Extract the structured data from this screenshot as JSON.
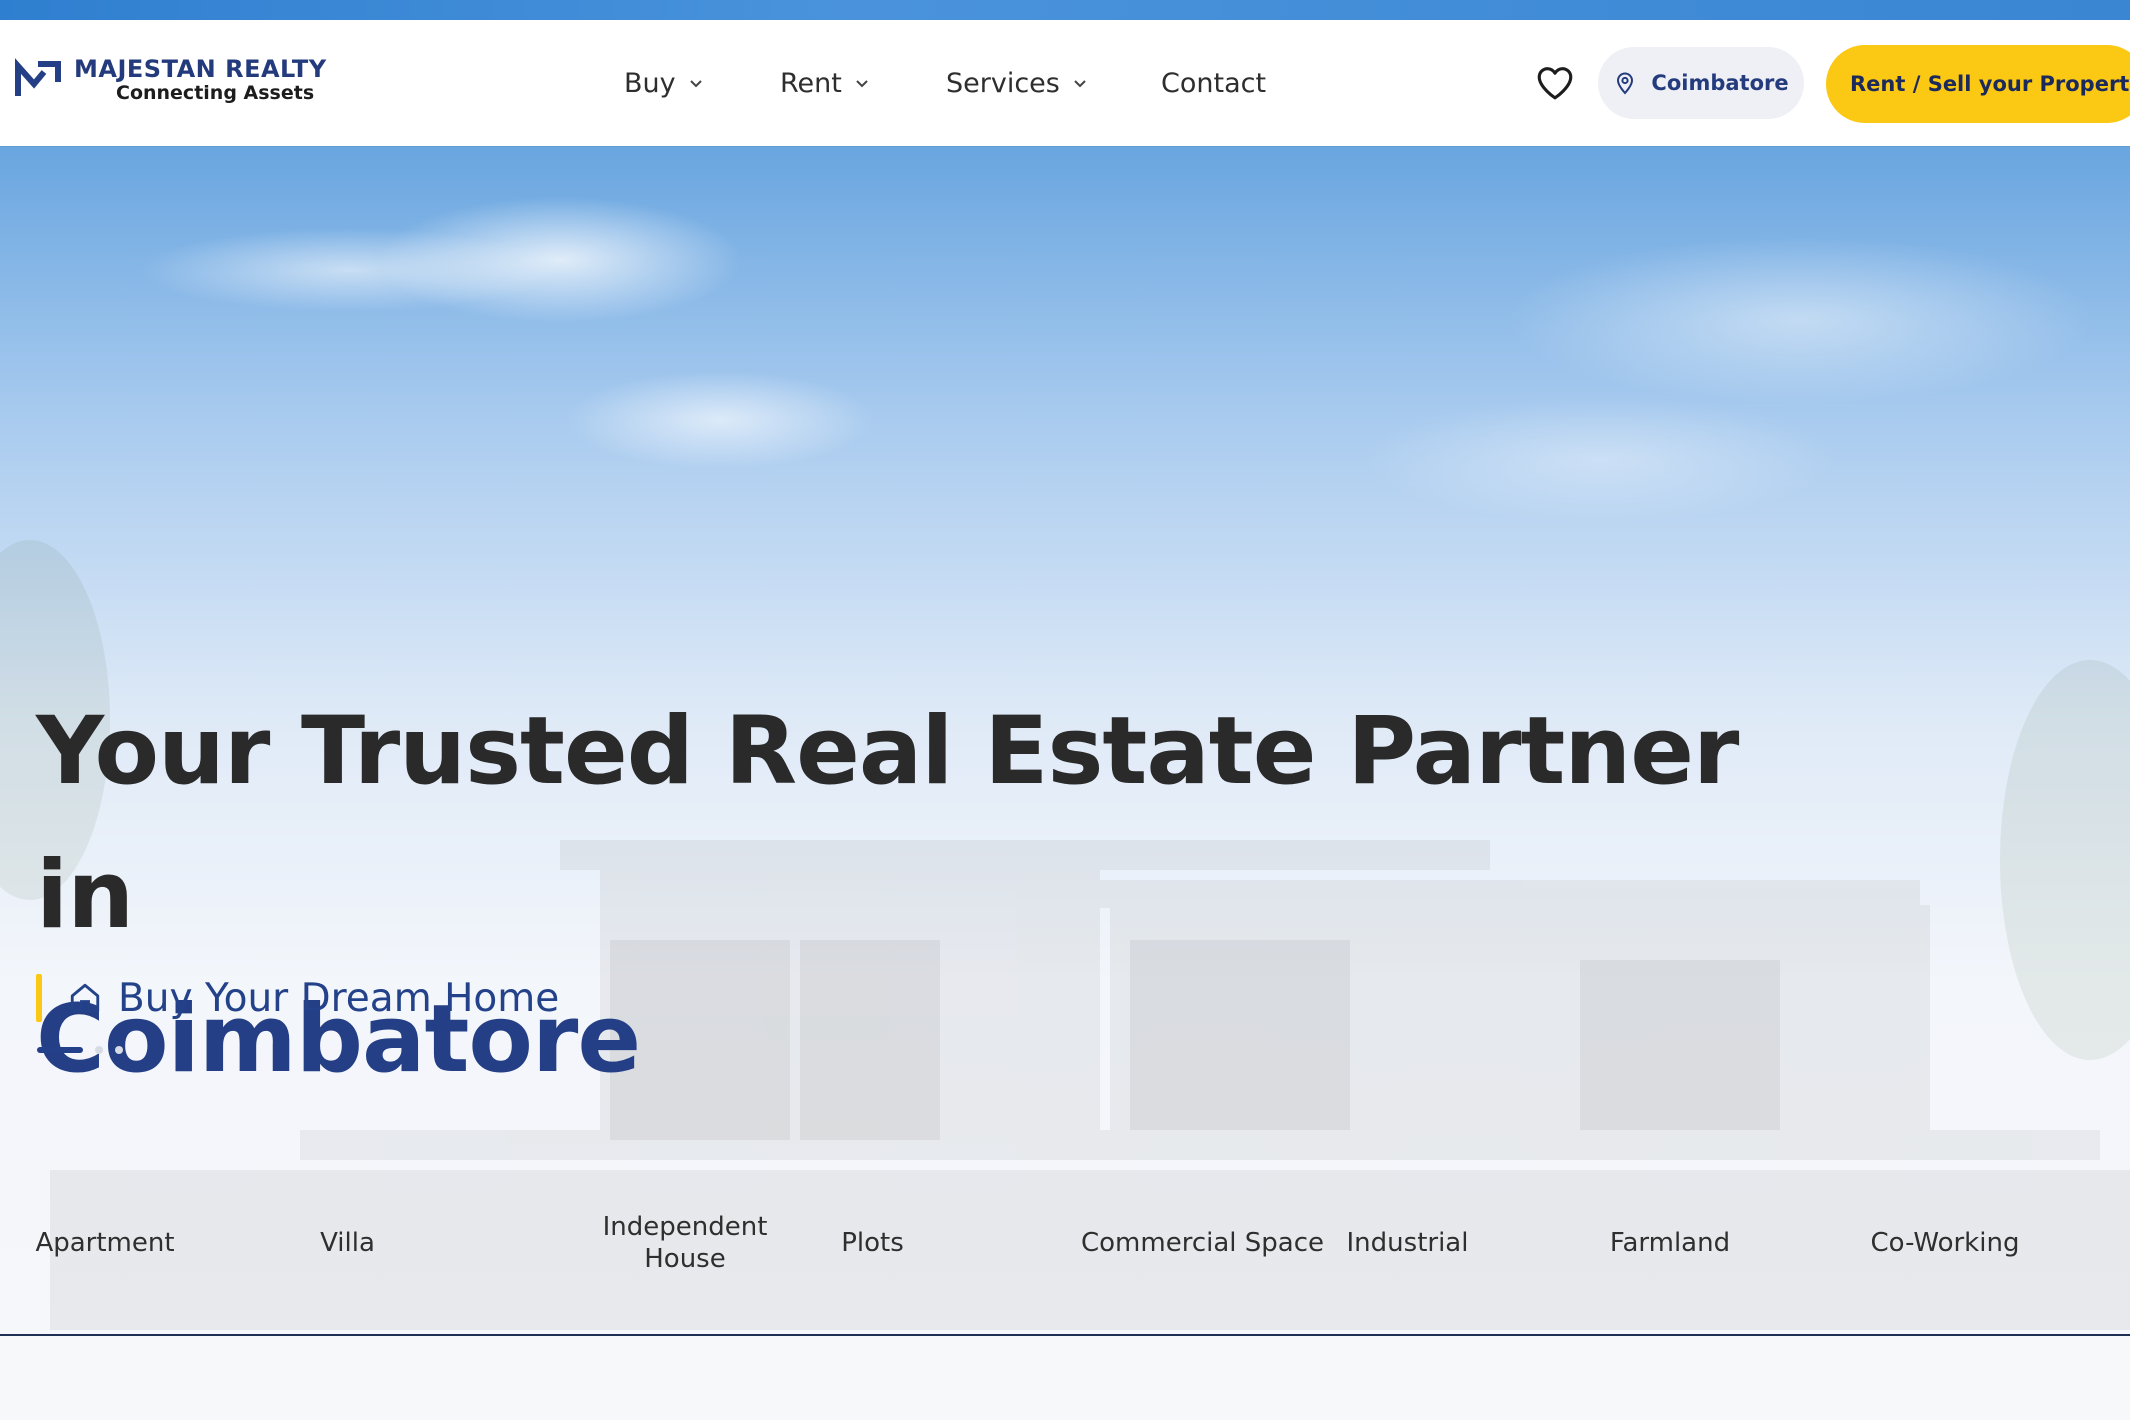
{
  "brand": {
    "name": "MAJESTAN REALTY",
    "tagline": "Connecting Assets",
    "primary_color": "#243f86",
    "accent_color": "#fbc813"
  },
  "nav": {
    "items": [
      {
        "label": "Buy",
        "has_dropdown": true
      },
      {
        "label": "Rent",
        "has_dropdown": true
      },
      {
        "label": "Services",
        "has_dropdown": true
      },
      {
        "label": "Contact",
        "has_dropdown": false
      }
    ]
  },
  "header": {
    "favorites_icon": "heart-icon",
    "location_label": "Coimbatore",
    "location_icon": "map-pin-icon",
    "cta_label": "Rent / Sell your Property"
  },
  "hero": {
    "title_line1": "Your Trusted Real Estate Partner in",
    "title_city": "Coimbatore",
    "tagline": "Buy Your Dream Home",
    "tagline_icon": "home-icon",
    "slides_total": 3,
    "active_slide": 1
  },
  "categories": [
    "Apartment",
    "Villa",
    "Independent House",
    "Plots",
    "Commercial Space",
    "Industrial",
    "Farmland",
    "Co-Working"
  ]
}
